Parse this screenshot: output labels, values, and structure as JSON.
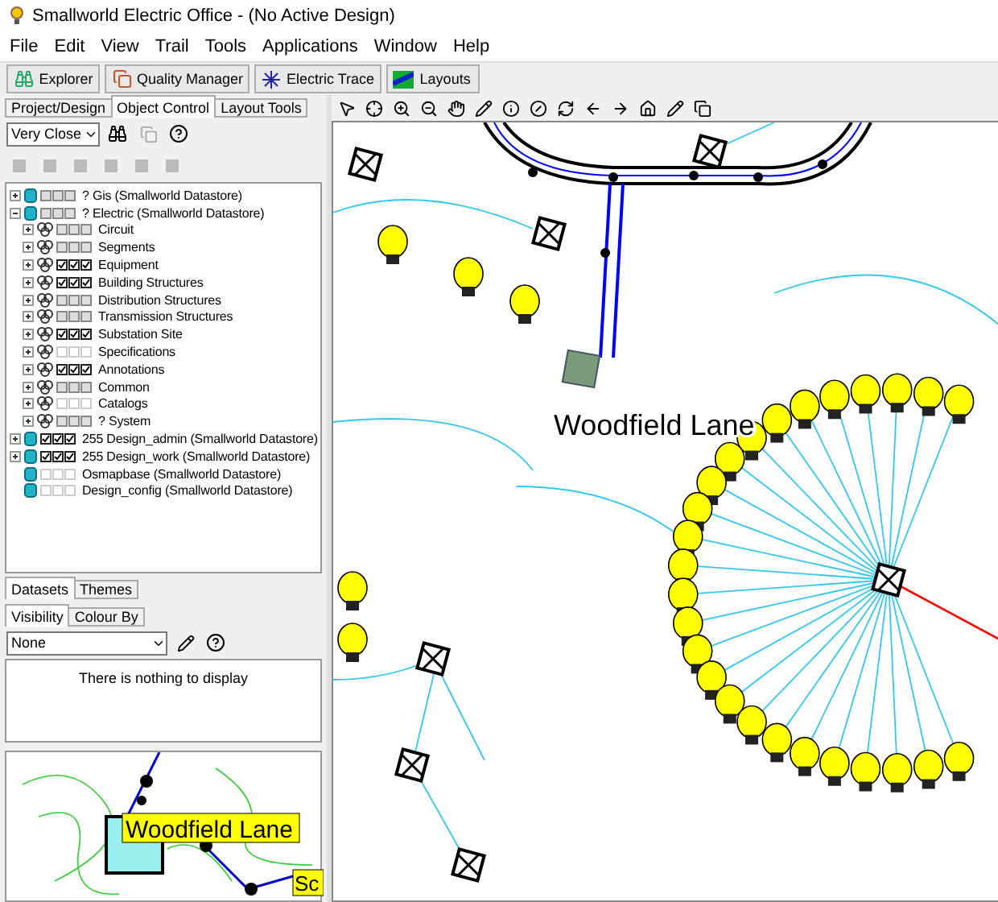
{
  "window": {
    "title": "Smallworld Electric Office - (No Active Design)"
  },
  "menu": [
    "File",
    "Edit",
    "View",
    "Trail",
    "Tools",
    "Applications",
    "Window",
    "Help"
  ],
  "toolbar": [
    "Explorer",
    "Quality Manager",
    "Electric Trace",
    "Layouts"
  ],
  "panel_tabs": [
    {
      "label": "Project/Design",
      "selected": false
    },
    {
      "label": "Object Control",
      "selected": true
    },
    {
      "label": "Layout Tools",
      "selected": false
    }
  ],
  "scale": {
    "value": "Very Close"
  },
  "tree": [
    {
      "label": "? Gis (Smallworld Datastore)",
      "kind": "datastore",
      "checked": false,
      "greyed": true,
      "expandable": true,
      "expanded": false
    },
    {
      "label": "? Electric (Smallworld Datastore)",
      "kind": "datastore",
      "checked": false,
      "greyed": true,
      "expandable": true,
      "expanded": true,
      "children": [
        {
          "label": "Circuit",
          "kind": "category",
          "checked": false,
          "greyed": true,
          "expandable": true,
          "expanded": false
        },
        {
          "label": "Segments",
          "kind": "category",
          "checked": false,
          "greyed": true,
          "expandable": true,
          "expanded": false
        },
        {
          "label": "Equipment",
          "kind": "category",
          "checked": true,
          "greyed": false,
          "expandable": true,
          "expanded": false
        },
        {
          "label": "Building Structures",
          "kind": "category",
          "checked": true,
          "greyed": false,
          "expandable": true,
          "expanded": false
        },
        {
          "label": "Distribution Structures",
          "kind": "category",
          "checked": false,
          "greyed": true,
          "expandable": true,
          "expanded": false
        },
        {
          "label": "Transmission Structures",
          "kind": "category",
          "checked": false,
          "greyed": true,
          "expandable": true,
          "expanded": false
        },
        {
          "label": "Substation Site",
          "kind": "category",
          "checked": true,
          "greyed": false,
          "expandable": true,
          "expanded": false
        },
        {
          "label": "Specifications",
          "kind": "category",
          "checked": false,
          "greyed": false,
          "expandable": true,
          "expanded": false
        },
        {
          "label": "Annotations",
          "kind": "category",
          "checked": true,
          "greyed": false,
          "expandable": true,
          "expanded": false
        },
        {
          "label": "Common",
          "kind": "category",
          "checked": false,
          "greyed": true,
          "expandable": true,
          "expanded": false
        },
        {
          "label": "Catalogs",
          "kind": "category",
          "checked": false,
          "greyed": false,
          "expandable": true,
          "expanded": false
        },
        {
          "label": "? System",
          "kind": "category",
          "checked": false,
          "greyed": true,
          "expandable": true,
          "expanded": false
        }
      ]
    },
    {
      "label": "255 Design_admin (Smallworld Datastore)",
      "kind": "datastore",
      "checked": true,
      "greyed": false,
      "expandable": true,
      "expanded": false
    },
    {
      "label": "255 Design_work (Smallworld Datastore)",
      "kind": "datastore",
      "checked": true,
      "greyed": false,
      "expandable": true,
      "expanded": false
    },
    {
      "label": "Osmapbase (Smallworld Datastore)",
      "kind": "datastore",
      "checked": false,
      "greyed": false,
      "expandable": false,
      "expanded": false
    },
    {
      "label": "Design_config (Smallworld Datastore)",
      "kind": "datastore",
      "checked": false,
      "greyed": false,
      "expandable": false,
      "expanded": false
    }
  ],
  "bottom_tabs": [
    {
      "label": "Datasets",
      "selected": true
    },
    {
      "label": "Themes",
      "selected": false
    }
  ],
  "sub_tabs": [
    {
      "label": "Visibility",
      "selected": true
    },
    {
      "label": "Colour By",
      "selected": false
    }
  ],
  "colour_by": {
    "value": "None"
  },
  "empty_message": "There is nothing to display",
  "map": {
    "street_label": "Woodfield Lane"
  },
  "overview": {
    "labels": [
      "Woodfield Lane",
      "Sc"
    ]
  }
}
